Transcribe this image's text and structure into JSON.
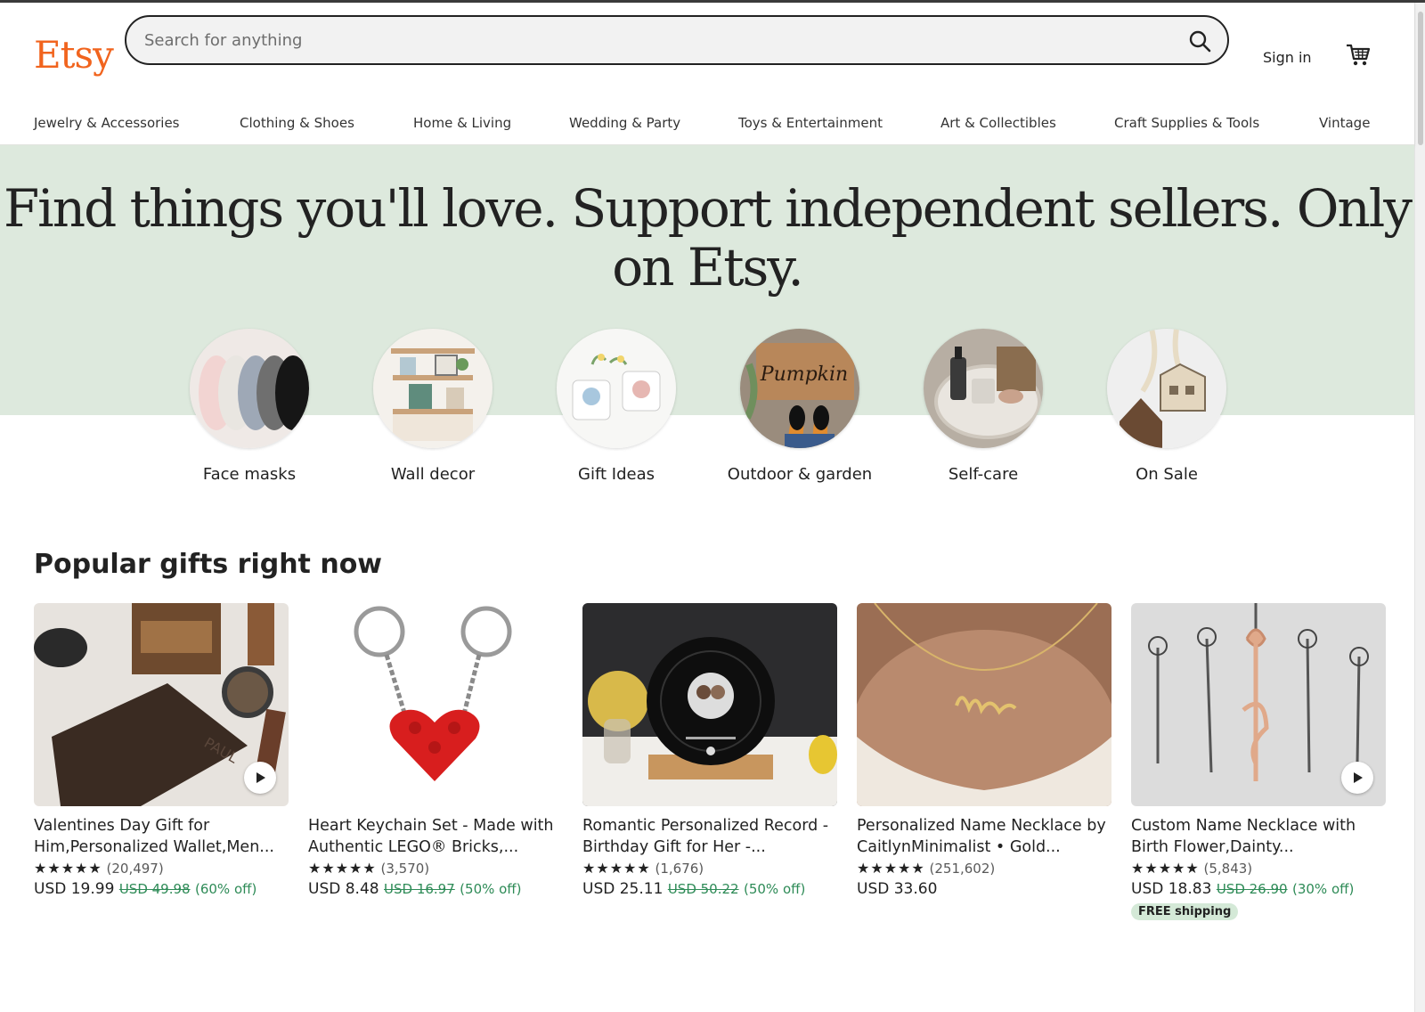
{
  "header": {
    "logo": "Etsy",
    "search_placeholder": "Search for anything",
    "signin": "Sign in"
  },
  "nav": [
    "Jewelry & Accessories",
    "Clothing & Shoes",
    "Home & Living",
    "Wedding & Party",
    "Toys & Entertainment",
    "Art & Collectibles",
    "Craft Supplies & Tools",
    "Vintage"
  ],
  "hero": {
    "title": "Find things you'll love. Support independent sellers. Only on Etsy."
  },
  "categories": [
    {
      "label": "Face masks"
    },
    {
      "label": "Wall decor"
    },
    {
      "label": "Gift Ideas"
    },
    {
      "label": "Outdoor & garden"
    },
    {
      "label": "Self-care"
    },
    {
      "label": "On Sale"
    }
  ],
  "popular": {
    "title": "Popular gifts right now",
    "items": [
      {
        "title": "Valentines Day Gift for Him,Personalized Wallet,Men...",
        "stars": "★★★★★",
        "reviews": "(20,497)",
        "price": "USD 19.99",
        "original": "USD 49.98",
        "discount": "(60% off)",
        "badge": ""
      },
      {
        "title": "Heart Keychain Set - Made with Authentic LEGO® Bricks,...",
        "stars": "★★★★★",
        "reviews": "(3,570)",
        "price": "USD 8.48",
        "original": "USD 16.97",
        "discount": "(50% off)",
        "badge": ""
      },
      {
        "title": "Romantic Personalized Record - Birthday Gift for Her -...",
        "stars": "★★★★★",
        "reviews": "(1,676)",
        "price": "USD 25.11",
        "original": "USD 50.22",
        "discount": "(50% off)",
        "badge": ""
      },
      {
        "title": "Personalized Name Necklace by CaitlynMinimalist • Gold...",
        "stars": "★★★★★",
        "reviews": "(251,602)",
        "price": "USD 33.60",
        "original": "",
        "discount": "",
        "badge": ""
      },
      {
        "title": "Custom Name Necklace with Birth Flower,Dainty...",
        "stars": "★★★★★",
        "reviews": "(5,843)",
        "price": "USD 18.83",
        "original": "USD 26.90",
        "discount": "(30% off)",
        "badge": "FREE shipping"
      }
    ]
  },
  "colors": {
    "brand": "#f1641e",
    "hero_bg": "#dde9dd",
    "sale_green": "#2e8b57"
  }
}
